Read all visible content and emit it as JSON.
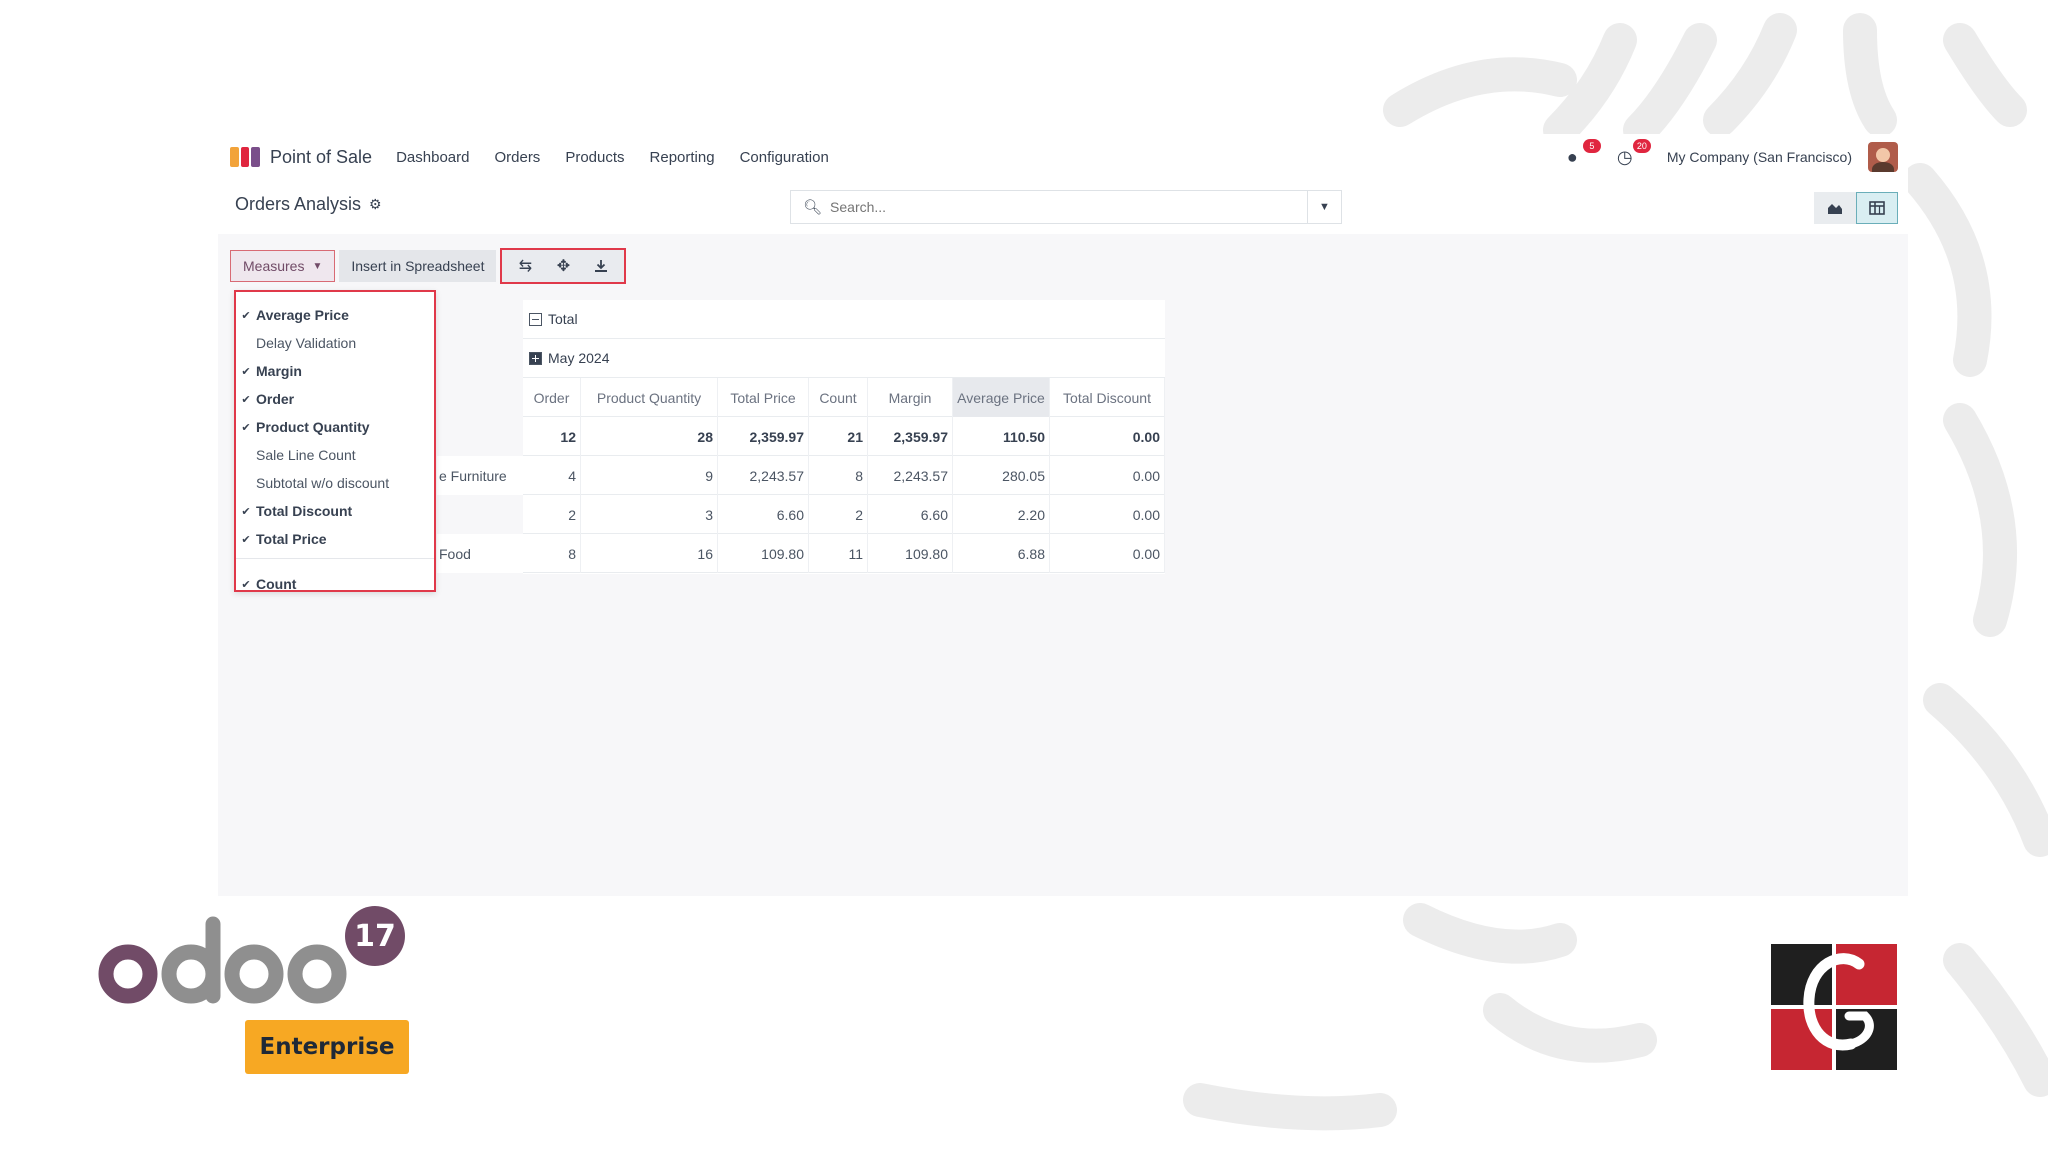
{
  "navbar": {
    "app_name": "Point of Sale",
    "menu": [
      "Dashboard",
      "Orders",
      "Products",
      "Reporting",
      "Configuration"
    ],
    "messages_badge": "5",
    "activities_badge": "20",
    "company": "My Company (San Francisco)"
  },
  "control_panel": {
    "title": "Orders Analysis",
    "search_placeholder": "Search..."
  },
  "toolbar": {
    "measures_label": "Measures",
    "insert_label": "Insert in Spreadsheet",
    "tools": [
      "flip-axis-icon",
      "expand-all-icon",
      "download-icon"
    ]
  },
  "measures": [
    {
      "label": "Average Price",
      "checked": true
    },
    {
      "label": "Delay Validation",
      "checked": false
    },
    {
      "label": "Margin",
      "checked": true
    },
    {
      "label": "Order",
      "checked": true
    },
    {
      "label": "Product Quantity",
      "checked": true
    },
    {
      "label": "Sale Line Count",
      "checked": false
    },
    {
      "label": "Subtotal w/o discount",
      "checked": false
    },
    {
      "label": "Total Discount",
      "checked": true
    },
    {
      "label": "Total Price",
      "checked": true
    },
    {
      "label": "Count",
      "checked": true
    }
  ],
  "pivot": {
    "col_group_total": "Total",
    "col_group_period": "May 2024",
    "columns": [
      "Order",
      "Product Quantity",
      "Total Price",
      "Count",
      "Margin",
      "Average Price",
      "Total Discount"
    ],
    "rows": [
      {
        "header": "",
        "values": [
          "12",
          "28",
          "2,359.97",
          "21",
          "2,359.97",
          "110.50",
          "0.00"
        ],
        "total": true
      },
      {
        "header": "e Furniture",
        "values": [
          "4",
          "9",
          "2,243.57",
          "8",
          "2,243.57",
          "280.05",
          "0.00"
        ],
        "total": false
      },
      {
        "header": "",
        "values": [
          "2",
          "3",
          "6.60",
          "2",
          "6.60",
          "2.20",
          "0.00"
        ],
        "total": false
      },
      {
        "header": "Food",
        "values": [
          "8",
          "16",
          "109.80",
          "11",
          "109.80",
          "6.88",
          "0.00"
        ],
        "total": false
      }
    ]
  },
  "branding": {
    "product": "odoo",
    "version": "17",
    "edition": "Enterprise"
  },
  "colors": {
    "primary": "#714b67",
    "highlight_border": "#e0394a",
    "enterprise": "#f7a823"
  }
}
